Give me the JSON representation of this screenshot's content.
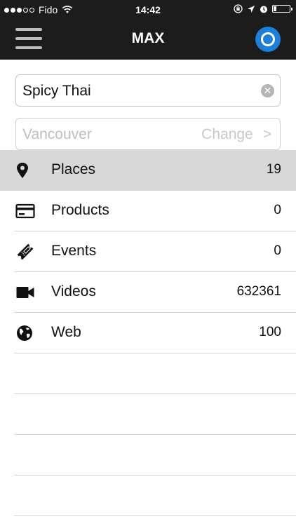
{
  "status_bar": {
    "carrier": "Fido",
    "time": "14:42",
    "signal_dots_filled": 3,
    "signal_dots_total": 5,
    "battery_level": 0.15
  },
  "nav": {
    "title": "MAX",
    "menu_icon": "hamburger-menu-icon",
    "assistant_icon": "cortana-circle-icon"
  },
  "search": {
    "value": "Spicy Thai",
    "clear_icon": "clear-x-icon"
  },
  "location": {
    "placeholder": "Vancouver",
    "change_label": "Change",
    "chevron": ">"
  },
  "categories": [
    {
      "label": "Places",
      "count": "19",
      "icon": "map-pin-icon",
      "selected": true
    },
    {
      "label": "Products",
      "count": "0",
      "icon": "credit-card-icon",
      "selected": false
    },
    {
      "label": "Events",
      "count": "0",
      "icon": "ticket-icon",
      "selected": false
    },
    {
      "label": "Videos",
      "count": "632361",
      "icon": "video-camera-icon",
      "selected": false
    },
    {
      "label": "Web",
      "count": "100",
      "icon": "globe-icon",
      "selected": false
    }
  ],
  "colors": {
    "nav_background": "#1c1c1c",
    "assistant_blue": "#1f7fd7",
    "selected_row": "#d8d8d8"
  }
}
